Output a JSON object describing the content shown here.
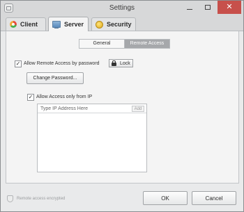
{
  "window": {
    "title": "Settings"
  },
  "tabs": [
    {
      "label": "Client",
      "icon": "client-icon"
    },
    {
      "label": "Server",
      "icon": "monitor-icon",
      "active": true
    },
    {
      "label": "Security",
      "icon": "security-icon"
    }
  ],
  "subtabs": [
    {
      "label": "General"
    },
    {
      "label": "Remote Access",
      "active": true
    }
  ],
  "remote_access": {
    "allow_remote_label": "Allow Remote Access by password",
    "allow_remote_checked": true,
    "lock_label": "Lock",
    "change_password_label": "Change Password...",
    "allow_ip_label": "Allow Access only from IP",
    "allow_ip_checked": true,
    "ip_placeholder": "Type IP Address Here",
    "add_label": "Add"
  },
  "status": {
    "text": "Remote access encrypted"
  },
  "footer": {
    "ok_label": "OK",
    "cancel_label": "Cancel"
  },
  "colors": {
    "close_button": "#c7504b",
    "active_subtab": "#a6a8ab"
  }
}
